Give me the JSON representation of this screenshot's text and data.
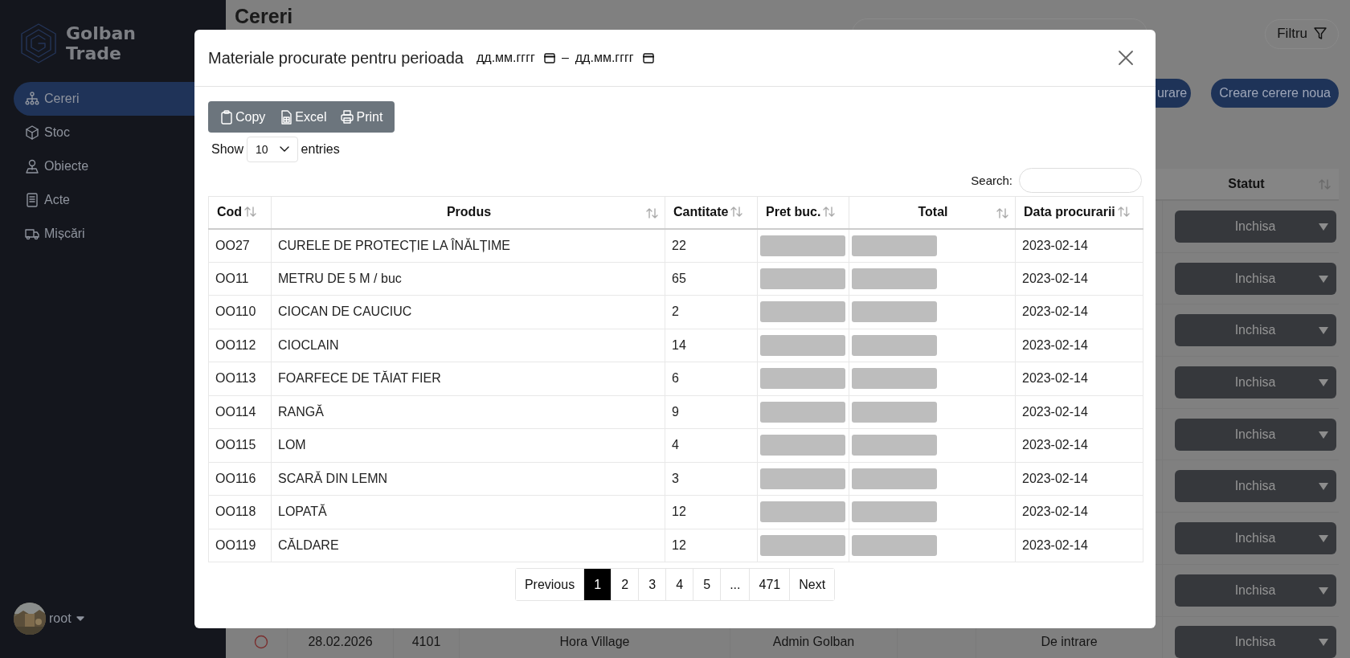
{
  "sidebar": {
    "logo": [
      "Golban",
      "Trade"
    ],
    "items": [
      {
        "label": "Cereri",
        "selected": true
      },
      {
        "label": "Stoc",
        "selected": false
      },
      {
        "label": "Obiecte",
        "selected": false
      },
      {
        "label": "Acte",
        "selected": false
      },
      {
        "label": "Mișcări",
        "selected": false
      }
    ],
    "user": {
      "name": "root"
    }
  },
  "page": {
    "title": "Cereri",
    "filter_button": "Filtru",
    "buttons": [
      "urare",
      "Creare cerere noua"
    ],
    "table": {
      "columns": [
        {
          "label": "Statut"
        }
      ],
      "rows": [
        {
          "status": "Inchisa"
        },
        {
          "status": "Inchisa"
        },
        {
          "status": "Inchisa"
        },
        {
          "status": "Inchisa"
        },
        {
          "status": "Inchisa"
        },
        {
          "status": "Inchisa"
        },
        {
          "status": "Inchisa"
        },
        {
          "status": "Inchisa"
        },
        {
          "cells": [
            "28.02.2026",
            "4101",
            "Hora Village",
            "Admin Golban",
            "De intrare"
          ],
          "status": "Inchisa"
        }
      ]
    }
  },
  "modal": {
    "title": "Materiale procurate pentru perioada",
    "date_from": {
      "placeholder": "дд.мм.гггг"
    },
    "separator": "–",
    "date_to": {
      "placeholder": "дд.мм.гггг"
    },
    "export_buttons": [
      "Copy",
      "Excel",
      "Print"
    ],
    "length": {
      "label_before": "Show",
      "value": "10",
      "label_after": "entries"
    },
    "search": {
      "label": "Search:"
    },
    "table": {
      "columns": [
        {
          "label": "Cod",
          "kind": "text"
        },
        {
          "label": "Produs",
          "kind": "text"
        },
        {
          "label": "Cantitate",
          "kind": "text"
        },
        {
          "label": "Pret buc.",
          "kind": "hidden"
        },
        {
          "label": "Total",
          "kind": "hidden"
        },
        {
          "label": "Data procurarii",
          "kind": "text"
        }
      ],
      "rows": [
        {
          "cells": [
            "OO27",
            "CURELE DE PROTECȚIE LA ÎNĂLȚIME",
            "22",
            "2023-02-14"
          ]
        },
        {
          "cells": [
            "OO11",
            "METRU DE 5 M / buc",
            "65",
            "2023-02-14"
          ]
        },
        {
          "cells": [
            "OO110",
            "CIOCAN DE CAUCIUC",
            "2",
            "2023-02-14"
          ]
        },
        {
          "cells": [
            "OO112",
            "CIOCLAIN",
            "14",
            "2023-02-14"
          ]
        },
        {
          "cells": [
            "OO113",
            "FOARFECE DE TĂIAT FIER",
            "6",
            "2023-02-14"
          ]
        },
        {
          "cells": [
            "OO114",
            "RANGĂ",
            "9",
            "2023-02-14"
          ]
        },
        {
          "cells": [
            "OO115",
            "LOM",
            "4",
            "2023-02-14"
          ]
        },
        {
          "cells": [
            "OO116",
            "SCARĂ DIN LEMN",
            "3",
            "2023-02-14"
          ]
        },
        {
          "cells": [
            "OO118",
            "LOPATĂ",
            "12",
            "2023-02-14"
          ]
        },
        {
          "cells": [
            "OO119",
            "CĂLDARE",
            "12",
            "2023-02-14"
          ]
        }
      ]
    },
    "pagination": [
      {
        "label": "Previous",
        "selected": false
      },
      {
        "label": "1",
        "selected": true
      },
      {
        "label": "2",
        "selected": false
      },
      {
        "label": "3",
        "selected": false
      },
      {
        "label": "4",
        "selected": false
      },
      {
        "label": "5",
        "selected": false
      },
      {
        "label": "...",
        "selected": false
      },
      {
        "label": "471",
        "selected": false
      },
      {
        "label": "Next",
        "selected": false
      }
    ]
  }
}
